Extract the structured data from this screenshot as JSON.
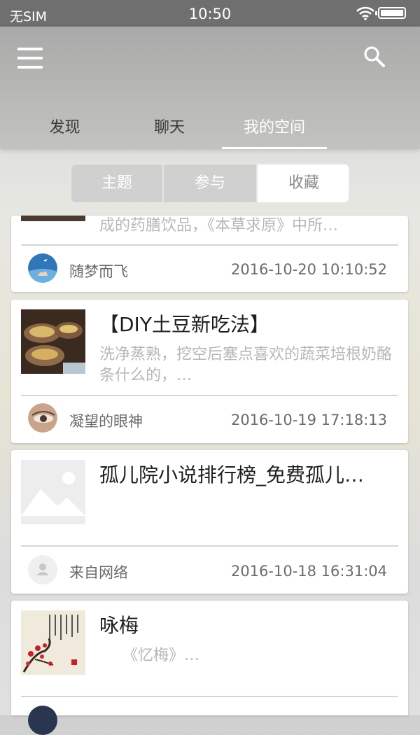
{
  "status_bar": {
    "carrier": "无SIM",
    "time": "10:50"
  },
  "header": {
    "menu_icon": "hamburger-menu-icon",
    "search_icon": "search-icon",
    "tabs": [
      {
        "label": "发现",
        "active": false
      },
      {
        "label": "聊天",
        "active": false
      },
      {
        "label": "我的空间",
        "active": true
      }
    ]
  },
  "segments": [
    {
      "label": "主题",
      "active": false
    },
    {
      "label": "参与",
      "active": false
    },
    {
      "label": "收藏",
      "active": true
    }
  ],
  "posts": [
    {
      "title": "",
      "summary": "成的药膳饮品，《本草求原》中所…",
      "author": "随梦而飞",
      "date": "2016-10-20 10:10:52"
    },
    {
      "title": "【DIY土豆新吃法】",
      "summary": "洗净蒸熟，挖空后塞点喜欢的蔬菜培根奶酪条什么的，…",
      "author": "凝望的眼神",
      "date": "2016-10-19 17:18:13"
    },
    {
      "title": "孤儿院小说排行榜_免费孤儿…",
      "summary": "",
      "author": "来自网络",
      "date": "2016-10-18 16:31:04"
    },
    {
      "title": "咏梅",
      "summary": "　　《忆梅》…",
      "author": "",
      "date": ""
    }
  ],
  "colors": {
    "accent": "#ffffff",
    "header_bg": "#b2b2b0",
    "status_bg": "#6f6f6f"
  }
}
